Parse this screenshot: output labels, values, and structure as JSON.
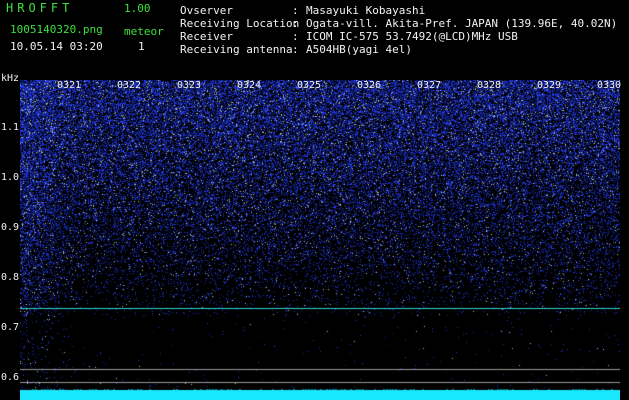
{
  "header": {
    "app_title": "HROFFT",
    "app_version": "1.00",
    "file_name": "1005140320.png",
    "meteor_label": "meteor",
    "datetime": "10.05.14 03:20",
    "meteor_count": "1"
  },
  "info": [
    {
      "label": "Ovserver",
      "value": "Masayuki Kobayashi"
    },
    {
      "label": "Receiving Location",
      "value": "Ogata-vill. Akita-Pref. JAPAN (139.96E, 40.02N)"
    },
    {
      "label": "Receiver",
      "value": "ICOM IC-575 53.7492(@LCD)MHz USB"
    },
    {
      "label": "Receiving antenna",
      "value": "A504HB(yagi 4el)"
    }
  ],
  "info_separator": ":",
  "axis": {
    "unit": "kHz",
    "y_ticks": [
      "1.1",
      "1.0",
      "0.9",
      "0.8",
      "0.7",
      "0.6"
    ],
    "x_ticks": [
      "0321",
      "0322",
      "0323",
      "0324",
      "0325",
      "0326",
      "0327",
      "0328",
      "0329",
      "0330"
    ]
  },
  "colors": {
    "background": "#000000",
    "header_green": "#3ee03e",
    "noise": "#2a3fd6",
    "carrier_line": "#2fd3d3",
    "bottom_band": "#19e8ff",
    "gray_lines": "#9a9a9a"
  }
}
